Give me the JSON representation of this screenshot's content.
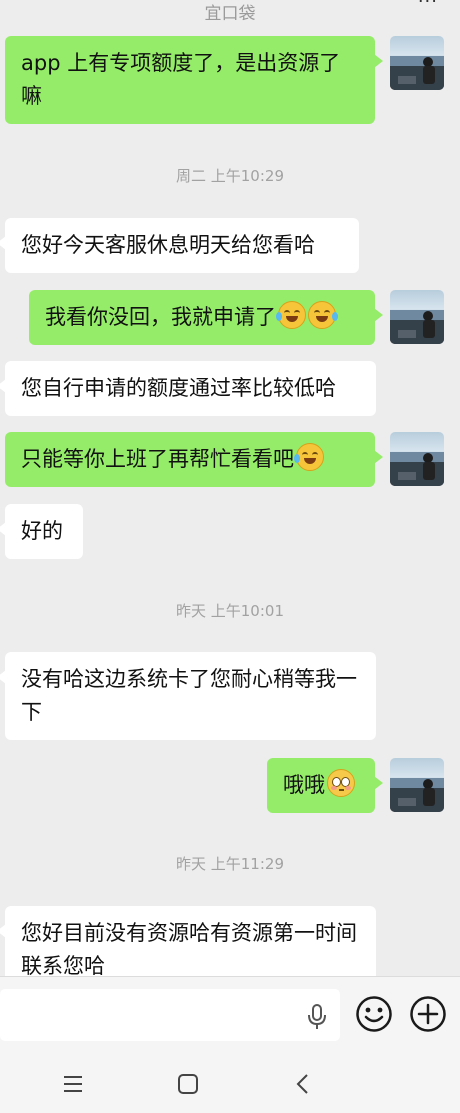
{
  "header": {
    "title": "宜口袋",
    "more": "···"
  },
  "messages": {
    "m1": "app 上有专项额度了，是出资源了嘛",
    "ts1": "周二 上午10:29",
    "m2": "您好今天客服休息明天给您看哈",
    "m3": "我看你没回，我就申请了",
    "m4": "您自行申请的额度通过率比较低哈",
    "m5": "只能等你上班了再帮忙看看吧",
    "m6": "好的",
    "ts2": "昨天 上午10:01",
    "m7": "没有哈这边系统卡了您耐心稍等我一下",
    "m8": "哦哦",
    "ts3": "昨天 上午11:29",
    "m9": "您好目前没有资源哈有资源第一时间联系您哈"
  },
  "emojis": {
    "laugh_cry": "face-with-tears-of-joy-icon",
    "flushed": "flushed-face-icon"
  },
  "input_bar": {
    "value": "",
    "icons": [
      "microphone-icon",
      "emoji-icon",
      "plus-icon"
    ]
  },
  "nav_bar": {
    "icons": [
      "menu-icon",
      "home-icon",
      "back-icon"
    ]
  },
  "colors": {
    "self_bubble": "#95ec69",
    "other_bubble": "#ffffff",
    "background": "#ededed"
  }
}
